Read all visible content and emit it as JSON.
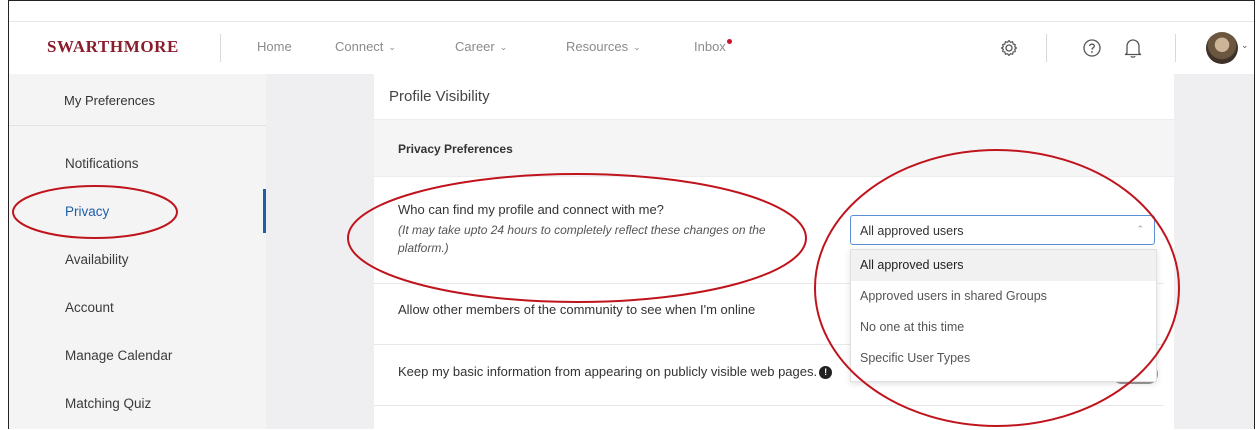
{
  "header": {
    "logo": "SWARTHMORE",
    "nav": {
      "home": "Home",
      "connect": "Connect",
      "career": "Career",
      "resources": "Resources",
      "inbox": "Inbox"
    },
    "icons": [
      "gear-icon",
      "help-icon",
      "bell-icon",
      "avatar"
    ],
    "brand_color": "#8a1d2b"
  },
  "sidebar": {
    "title": "My Preferences",
    "items": [
      {
        "label": "Notifications"
      },
      {
        "label": "Privacy",
        "active": true
      },
      {
        "label": "Availability"
      },
      {
        "label": "Account"
      },
      {
        "label": "Manage Calendar"
      },
      {
        "label": "Matching Quiz"
      }
    ],
    "active_color": "#1f5fa8"
  },
  "main": {
    "section_title": "Profile Visibility",
    "subsection_title": "Privacy Preferences",
    "question1": "Who can find my profile and connect with me?",
    "question1_note": "(It may take upto 24 hours to completely reflect these changes on the platform.)",
    "question2": "Allow other members of the community to see when I'm online",
    "question3": "Keep my basic information from appearing on publicly visible web pages.",
    "select": {
      "value": "All approved users",
      "options": [
        "All approved users",
        "Approved users in shared Groups",
        "No one at this time",
        "Specific User Types"
      ]
    }
  },
  "annotation_color": "#c0141d"
}
